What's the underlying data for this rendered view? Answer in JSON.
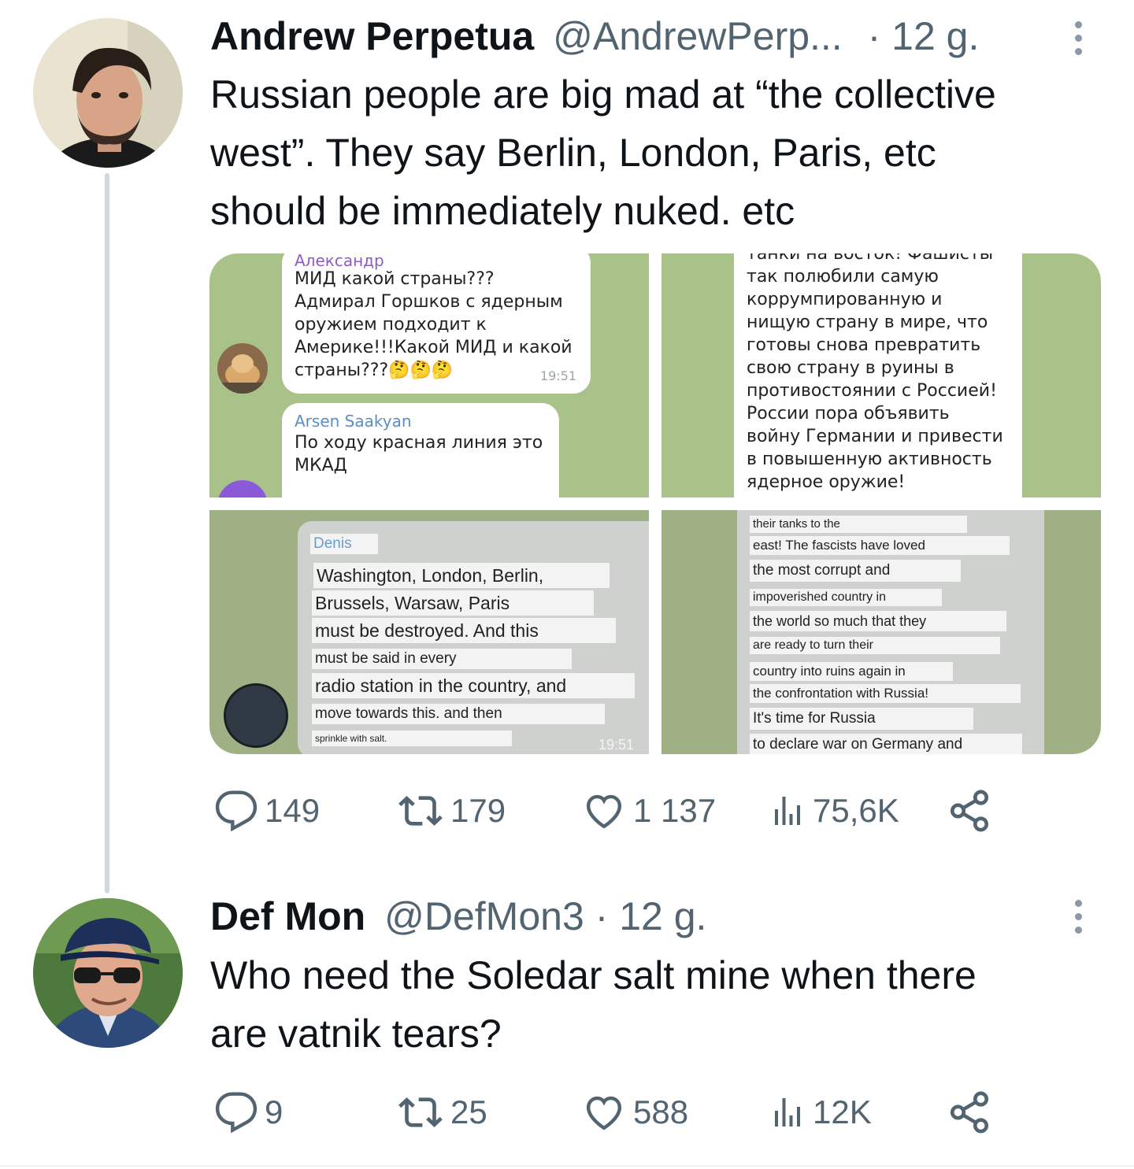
{
  "tweet1": {
    "author_name": "Andrew Perpetua",
    "handle": "@AndrewPerp...",
    "separator": "·",
    "time": "12 g.",
    "text_lines": [
      "Russian people are big mad at “the collective",
      "west”. They say Berlin, London, Paris, etc",
      "should be immediately nuked. etc"
    ],
    "media": {
      "tile1": {
        "sender1": "Александр",
        "msg1_lines": [
          "МИД какой страны???",
          "Адмирал Горшков с ядерным",
          "оружием подходит к",
          "Америке!!!Какой МИД и какой",
          "страны???🤔🤔🤔"
        ],
        "time1": "19:51",
        "sender2": "Arsen Saakyan",
        "msg2_lines": [
          "По ходу красная линия это",
          "МКАД"
        ]
      },
      "tile2": {
        "msg_lines": [
          "танки на восток! Фашисты",
          "так полюбили самую",
          "коррумпированную и",
          "нищую страну в мире, что",
          "готовы снова превратить",
          "свою страну в руины в",
          "противостоянии с Россией!",
          "России пора объявить",
          "войну Германии и привести",
          "в повышенную активность",
          "ядерное оружие!"
        ]
      },
      "tile3": {
        "sender": "Denis",
        "msg_lines": [
          "Washington, London, Berlin,",
          "Brussels, Warsaw, Paris",
          "must be destroyed. And this",
          "must be said in every",
          "radio station in the country, and",
          "move towards this. and then",
          "sprinkle with salt."
        ],
        "time": "19:51"
      },
      "tile4": {
        "msg_lines": [
          "their tanks to the",
          "east! The fascists have loved",
          "the most corrupt and",
          "impoverished country in",
          "the world so much that they",
          "are ready to turn their",
          "country into ruins again in",
          "the confrontation with Russia!",
          "It's time for Russia",
          "to declare war on Germany and"
        ]
      }
    },
    "stats": {
      "replies": "149",
      "retweets": "179",
      "likes": "1 137",
      "views": "75,6K"
    }
  },
  "tweet2": {
    "author_name": "Def Mon",
    "handle": "@DefMon3",
    "separator": "·",
    "time": "12 g.",
    "text_lines": [
      "Who need the Soledar salt mine when there",
      "are vatnik tears?"
    ],
    "stats": {
      "replies": "9",
      "retweets": "25",
      "likes": "588",
      "views": "12K"
    }
  },
  "icons": [
    "reply-icon",
    "retweet-icon",
    "like-icon",
    "views-icon",
    "share-icon",
    "more-icon"
  ],
  "colors": {
    "text": "#0f1419",
    "muted": "#536471",
    "thread_line": "#cfd9de",
    "telegram_bg": "#a9c28a"
  }
}
